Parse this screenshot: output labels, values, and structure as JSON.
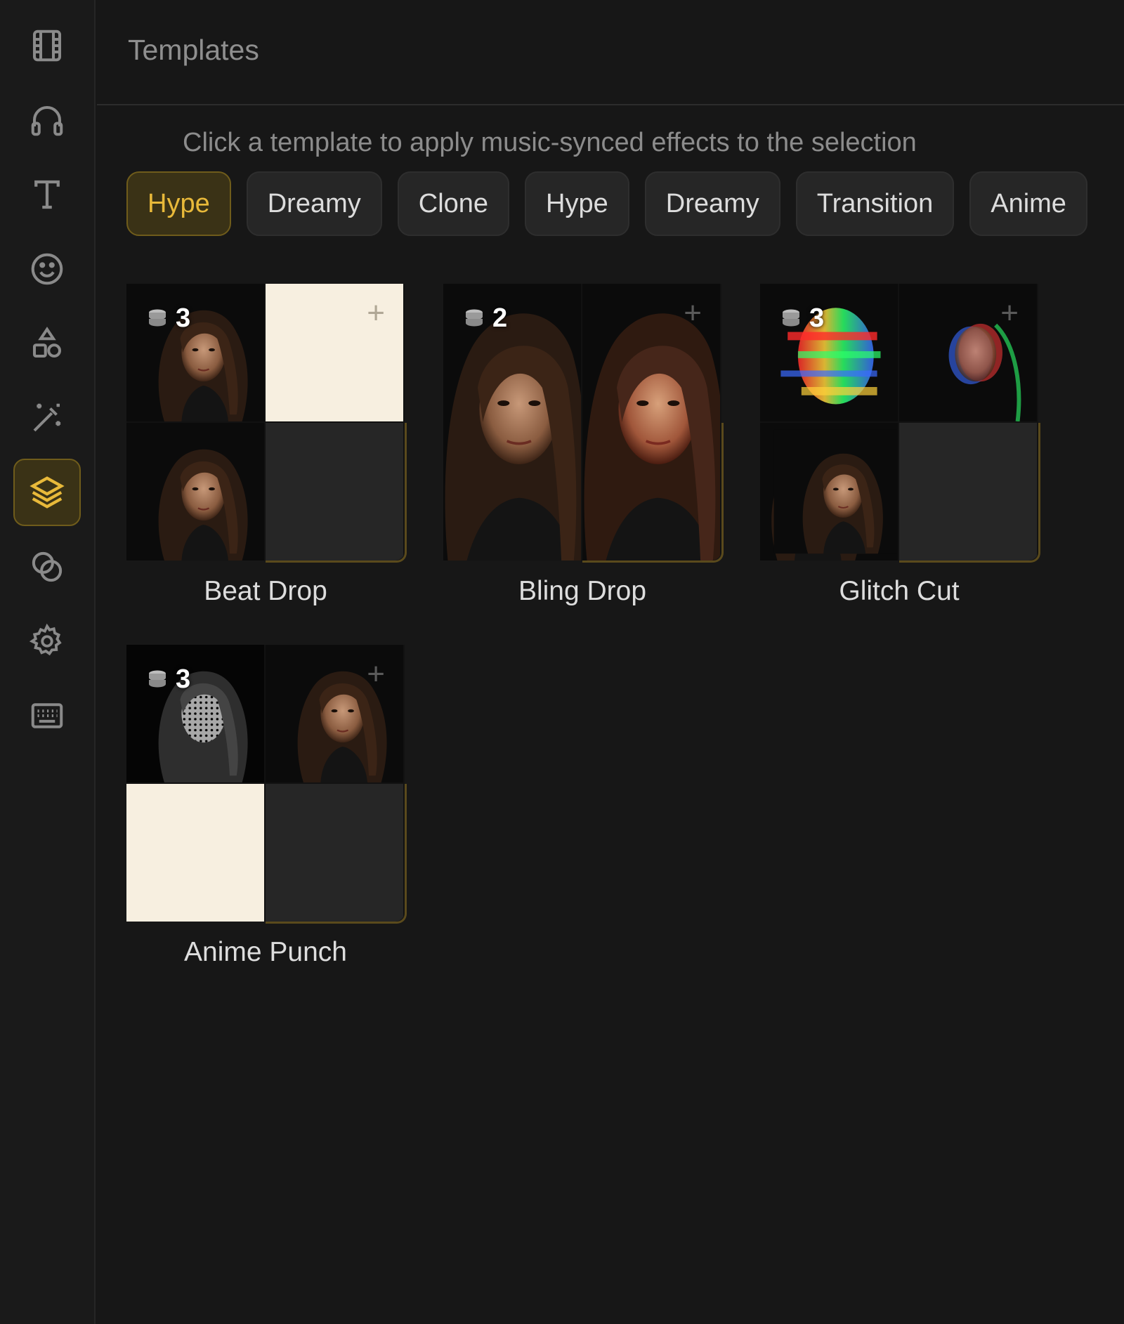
{
  "sidebar": {
    "items": [
      {
        "icon": "film-icon",
        "active": false
      },
      {
        "icon": "headphones-icon",
        "active": false
      },
      {
        "icon": "text-icon",
        "active": false
      },
      {
        "icon": "smiley-icon",
        "active": false
      },
      {
        "icon": "shapes-icon",
        "active": false
      },
      {
        "icon": "magic-wand-icon",
        "active": false
      },
      {
        "icon": "layers-icon",
        "active": true
      },
      {
        "icon": "overlap-circles-icon",
        "active": false
      },
      {
        "icon": "gear-icon",
        "active": false
      },
      {
        "icon": "keyboard-icon",
        "active": false
      }
    ]
  },
  "header": {
    "title": "Templates"
  },
  "instruction": "Click a template to apply music-synced effects to the selection",
  "filters": [
    {
      "label": "Hype",
      "active": true
    },
    {
      "label": "Dreamy",
      "active": false
    },
    {
      "label": "Clone",
      "active": false
    },
    {
      "label": "Hype",
      "active": false
    },
    {
      "label": "Dreamy",
      "active": false
    },
    {
      "label": "Transition",
      "active": false
    },
    {
      "label": "Anime",
      "active": false
    }
  ],
  "templates": [
    {
      "name": "Beat Drop",
      "layers": "3"
    },
    {
      "name": "Bling Drop",
      "layers": "2"
    },
    {
      "name": "Glitch Cut",
      "layers": "3"
    },
    {
      "name": "Anime Punch",
      "layers": "3"
    }
  ],
  "colors": {
    "background": "#171717",
    "accent": "#e8b93a",
    "accent_bg": "#3a3216"
  }
}
